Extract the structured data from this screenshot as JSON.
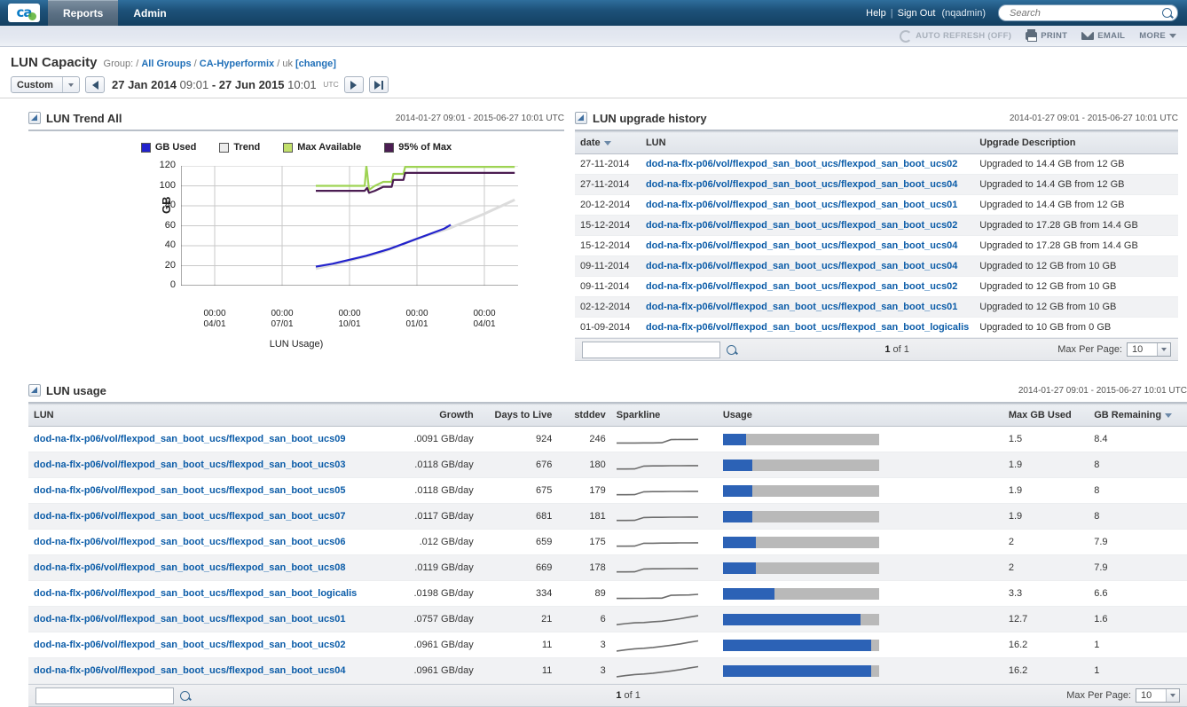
{
  "topnav": {
    "logo_text": "ca",
    "tabs": [
      {
        "label": "Reports",
        "active": true
      },
      {
        "label": "Admin",
        "active": false
      }
    ],
    "help_label": "Help",
    "separator": "|",
    "signout_label": "Sign Out",
    "user_label": "(nqadmin)",
    "search_placeholder": "Search",
    "search_value": ""
  },
  "toolbar": {
    "auto_refresh_label": "AUTO REFRESH (OFF)",
    "print_label": "PRINT",
    "email_label": "EMAIL",
    "more_label": "MORE"
  },
  "pagehead": {
    "title": "LUN Capacity",
    "group_label": "Group:",
    "sep": "/",
    "group_all": "All Groups",
    "group_company": "CA-Hyperformix",
    "group_leaf": "uk",
    "change_label": "[change]",
    "range_preset": "Custom",
    "start_date": "27 Jan 2014",
    "start_time": "09:01",
    "dash": "-",
    "end_date": "27 Jun 2015",
    "end_time": "10:01",
    "tz": "UTC"
  },
  "trend_panel": {
    "title": "LUN Trend All",
    "date_range": "2014-01-27 09:01 - 2015-06-27 10:01 UTC"
  },
  "chart_data": {
    "type": "line",
    "title": "LUN Trend All",
    "caption": "LUN Usage)",
    "xlabel": "",
    "ylabel": "GB",
    "ylim": [
      0,
      120
    ],
    "yticks": [
      0,
      20,
      40,
      60,
      80,
      100,
      120
    ],
    "xticks": [
      "00:00\n04/01",
      "00:00\n07/01",
      "00:00\n10/01",
      "00:00\n01/01",
      "00:00\n04/01"
    ],
    "xtick_times": [
      "00:00",
      "00:00",
      "00:00",
      "00:00",
      "00:00"
    ],
    "xtick_dates": [
      "04/01",
      "07/01",
      "10/01",
      "01/01",
      "04/01"
    ],
    "grid": true,
    "legend_position": "top",
    "legend": [
      {
        "name": "GB Used",
        "color": "#2222cc"
      },
      {
        "name": "Trend",
        "color": "#e8e8e8"
      },
      {
        "name": "Max Available",
        "color": "#9ed353"
      },
      {
        "name": "95% of Max",
        "color": "#4b1d52"
      }
    ],
    "series": [
      {
        "name": "GB Used",
        "color": "#2222cc",
        "points": [
          [
            0.4,
            19
          ],
          [
            0.45,
            22
          ],
          [
            0.5,
            26
          ],
          [
            0.55,
            30
          ],
          [
            0.58,
            33
          ],
          [
            0.62,
            37
          ],
          [
            0.66,
            42
          ],
          [
            0.7,
            47
          ],
          [
            0.74,
            52
          ],
          [
            0.78,
            57
          ],
          [
            0.8,
            61
          ]
        ]
      },
      {
        "name": "Trend",
        "color": "#dcdcdc",
        "points": [
          [
            0.4,
            17
          ],
          [
            0.5,
            25
          ],
          [
            0.6,
            34
          ],
          [
            0.7,
            47
          ],
          [
            0.8,
            58
          ],
          [
            0.9,
            72
          ],
          [
            0.99,
            86
          ]
        ]
      },
      {
        "name": "Max Available",
        "color": "#9ed353",
        "points": [
          [
            0.4,
            100
          ],
          [
            0.5,
            100
          ],
          [
            0.545,
            100
          ],
          [
            0.55,
            120
          ],
          [
            0.558,
            96
          ],
          [
            0.575,
            100
          ],
          [
            0.6,
            104
          ],
          [
            0.625,
            104
          ],
          [
            0.63,
            112
          ],
          [
            0.66,
            112
          ],
          [
            0.665,
            119
          ],
          [
            0.99,
            119
          ]
        ]
      },
      {
        "name": "95% of Max",
        "color": "#4b1d52",
        "points": [
          [
            0.4,
            95
          ],
          [
            0.5,
            95
          ],
          [
            0.545,
            95
          ],
          [
            0.552,
            98
          ],
          [
            0.558,
            93
          ],
          [
            0.575,
            95
          ],
          [
            0.6,
            99
          ],
          [
            0.625,
            99
          ],
          [
            0.63,
            106
          ],
          [
            0.66,
            106
          ],
          [
            0.665,
            113
          ],
          [
            0.99,
            113
          ]
        ]
      }
    ]
  },
  "upgrade_panel": {
    "title": "LUN upgrade history",
    "date_range": "2014-01-27 09:01 - 2015-06-27 10:01 UTC",
    "columns": [
      "date",
      "LUN",
      "Upgrade Description"
    ],
    "sort_column": "date",
    "rows": [
      {
        "date": "27-11-2014",
        "lun": "dod-na-flx-p06/vol/flexpod_san_boot_ucs/flexpod_san_boot_ucs02",
        "desc": "Upgraded to 14.4 GB from 12 GB"
      },
      {
        "date": "27-11-2014",
        "lun": "dod-na-flx-p06/vol/flexpod_san_boot_ucs/flexpod_san_boot_ucs04",
        "desc": "Upgraded to 14.4 GB from 12 GB"
      },
      {
        "date": "20-12-2014",
        "lun": "dod-na-flx-p06/vol/flexpod_san_boot_ucs/flexpod_san_boot_ucs01",
        "desc": "Upgraded to 14.4 GB from 12 GB"
      },
      {
        "date": "15-12-2014",
        "lun": "dod-na-flx-p06/vol/flexpod_san_boot_ucs/flexpod_san_boot_ucs02",
        "desc": "Upgraded to 17.28 GB from 14.4 GB"
      },
      {
        "date": "15-12-2014",
        "lun": "dod-na-flx-p06/vol/flexpod_san_boot_ucs/flexpod_san_boot_ucs04",
        "desc": "Upgraded to 17.28 GB from 14.4 GB"
      },
      {
        "date": "09-11-2014",
        "lun": "dod-na-flx-p06/vol/flexpod_san_boot_ucs/flexpod_san_boot_ucs04",
        "desc": "Upgraded to 12 GB from 10 GB"
      },
      {
        "date": "09-11-2014",
        "lun": "dod-na-flx-p06/vol/flexpod_san_boot_ucs/flexpod_san_boot_ucs02",
        "desc": "Upgraded to 12 GB from 10 GB"
      },
      {
        "date": "02-12-2014",
        "lun": "dod-na-flx-p06/vol/flexpod_san_boot_ucs/flexpod_san_boot_ucs01",
        "desc": "Upgraded to 12 GB from 10 GB"
      },
      {
        "date": "01-09-2014",
        "lun": "dod-na-flx-p06/vol/flexpod_san_boot_ucs/flexpod_san_boot_logicalis",
        "desc": "Upgraded to 10 GB from 0 GB"
      }
    ],
    "pager": {
      "search_value": "",
      "page_current": "1",
      "page_of": "of 1",
      "max_per_page_label": "Max Per Page:",
      "max_per_page_value": "10"
    }
  },
  "usage_panel": {
    "title": "LUN usage",
    "date_range": "2014-01-27 09:01 - 2015-06-27 10:01 UTC",
    "columns": [
      "LUN",
      "Growth",
      "Days to Live",
      "stddev",
      "Sparkline",
      "Usage",
      "Max GB Used",
      "GB Remaining"
    ],
    "sort_column": "GB Remaining",
    "rows": [
      {
        "lun": "dod-na-flx-p06/vol/flexpod_san_boot_ucs/flexpod_san_boot_ucs09",
        "growth": ".0091 GB/day",
        "days": "924",
        "stddev": "246",
        "max_gb": "1.5",
        "remaining": "8.4",
        "used_pct": 15,
        "total_pct": 100,
        "spark": [
          0.3,
          0.3,
          0.3,
          0.31,
          0.31,
          0.32,
          0.55,
          0.56,
          0.56,
          0.57
        ]
      },
      {
        "lun": "dod-na-flx-p06/vol/flexpod_san_boot_ucs/flexpod_san_boot_ucs03",
        "growth": ".0118 GB/day",
        "days": "676",
        "stddev": "180",
        "max_gb": "1.9",
        "remaining": "8",
        "used_pct": 19,
        "total_pct": 100,
        "spark": [
          0.28,
          0.28,
          0.29,
          0.5,
          0.51,
          0.51,
          0.52,
          0.52,
          0.53,
          0.53
        ]
      },
      {
        "lun": "dod-na-flx-p06/vol/flexpod_san_boot_ucs/flexpod_san_boot_ucs05",
        "growth": ".0118 GB/day",
        "days": "675",
        "stddev": "179",
        "max_gb": "1.9",
        "remaining": "8",
        "used_pct": 19,
        "total_pct": 100,
        "spark": [
          0.28,
          0.28,
          0.29,
          0.5,
          0.51,
          0.51,
          0.52,
          0.52,
          0.53,
          0.53
        ]
      },
      {
        "lun": "dod-na-flx-p06/vol/flexpod_san_boot_ucs/flexpod_san_boot_ucs07",
        "growth": ".0117 GB/day",
        "days": "681",
        "stddev": "181",
        "max_gb": "1.9",
        "remaining": "8",
        "used_pct": 19,
        "total_pct": 100,
        "spark": [
          0.28,
          0.28,
          0.29,
          0.5,
          0.51,
          0.51,
          0.52,
          0.52,
          0.53,
          0.53
        ]
      },
      {
        "lun": "dod-na-flx-p06/vol/flexpod_san_boot_ucs/flexpod_san_boot_ucs06",
        "growth": ".012 GB/day",
        "days": "659",
        "stddev": "175",
        "max_gb": "2",
        "remaining": "7.9",
        "used_pct": 21,
        "total_pct": 100,
        "spark": [
          0.28,
          0.28,
          0.29,
          0.5,
          0.5,
          0.51,
          0.51,
          0.52,
          0.52,
          0.53
        ]
      },
      {
        "lun": "dod-na-flx-p06/vol/flexpod_san_boot_ucs/flexpod_san_boot_ucs08",
        "growth": ".0119 GB/day",
        "days": "669",
        "stddev": "178",
        "max_gb": "2",
        "remaining": "7.9",
        "used_pct": 21,
        "total_pct": 100,
        "spark": [
          0.28,
          0.28,
          0.29,
          0.5,
          0.51,
          0.51,
          0.52,
          0.52,
          0.53,
          0.53
        ]
      },
      {
        "lun": "dod-na-flx-p06/vol/flexpod_san_boot_ucs/flexpod_san_boot_logicalis",
        "growth": ".0198 GB/day",
        "days": "334",
        "stddev": "89",
        "max_gb": "3.3",
        "remaining": "6.6",
        "used_pct": 33,
        "total_pct": 100,
        "spark": [
          0.22,
          0.22,
          0.23,
          0.23,
          0.24,
          0.24,
          0.45,
          0.47,
          0.48,
          0.52
        ]
      },
      {
        "lun": "dod-na-flx-p06/vol/flexpod_san_boot_ucs/flexpod_san_boot_ucs01",
        "growth": ".0757 GB/day",
        "days": "21",
        "stddev": "6",
        "max_gb": "12.7",
        "remaining": "1.6",
        "used_pct": 88,
        "total_pct": 100,
        "spark": [
          0.18,
          0.26,
          0.32,
          0.34,
          0.4,
          0.44,
          0.52,
          0.62,
          0.74,
          0.84
        ]
      },
      {
        "lun": "dod-na-flx-p06/vol/flexpod_san_boot_ucs/flexpod_san_boot_ucs02",
        "growth": ".0961 GB/day",
        "days": "11",
        "stddev": "3",
        "max_gb": "16.2",
        "remaining": "1",
        "used_pct": 95,
        "total_pct": 100,
        "spark": [
          0.14,
          0.22,
          0.3,
          0.34,
          0.4,
          0.48,
          0.56,
          0.66,
          0.78,
          0.88
        ]
      },
      {
        "lun": "dod-na-flx-p06/vol/flexpod_san_boot_ucs/flexpod_san_boot_ucs04",
        "growth": ".0961 GB/day",
        "days": "11",
        "stddev": "3",
        "max_gb": "16.2",
        "remaining": "1",
        "used_pct": 95,
        "total_pct": 100,
        "spark": [
          0.14,
          0.22,
          0.3,
          0.34,
          0.4,
          0.48,
          0.56,
          0.66,
          0.78,
          0.88
        ]
      }
    ],
    "pager": {
      "search_value": "",
      "page_current": "1",
      "page_of": "of 1",
      "max_per_page_label": "Max Per Page:",
      "max_per_page_value": "10"
    }
  }
}
